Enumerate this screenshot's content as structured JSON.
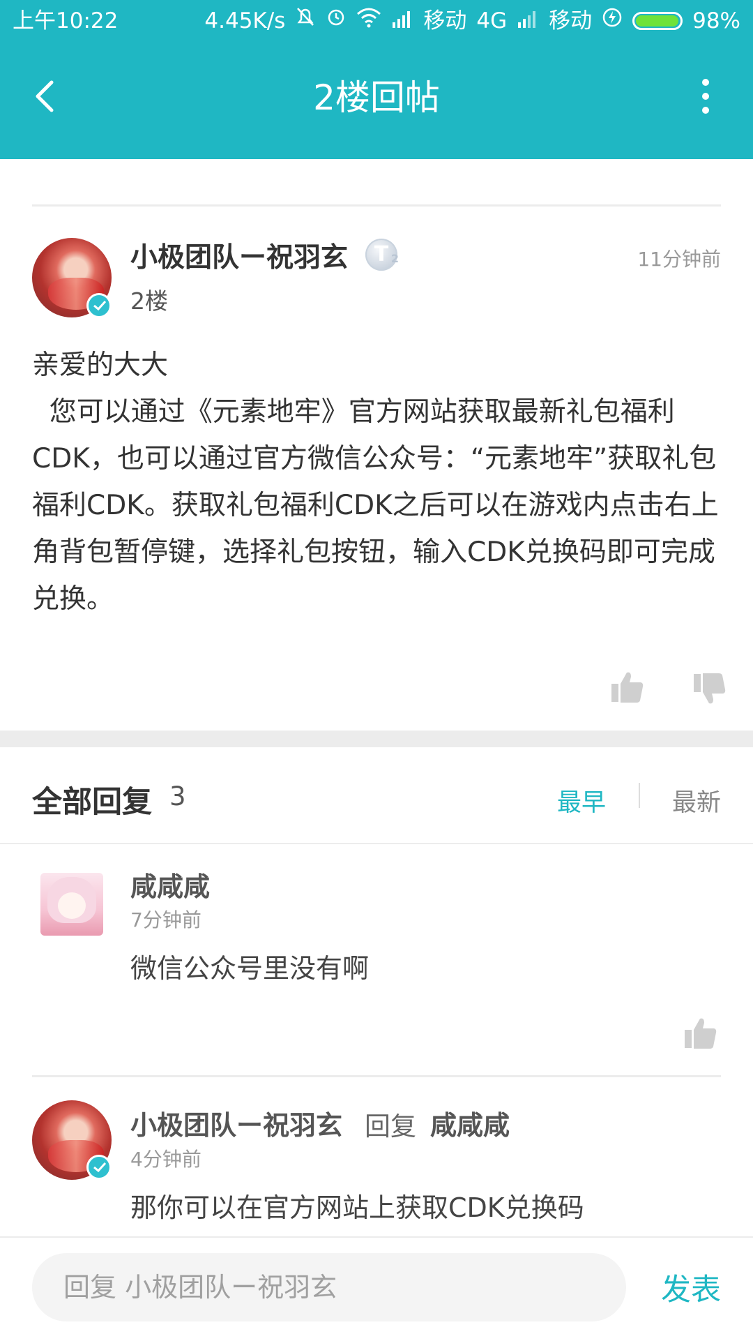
{
  "status_bar": {
    "time": "上午10:22",
    "speed": "4.45K/s",
    "carrier1": "移动",
    "network": "4G",
    "carrier2": "移动",
    "battery_text": "98%",
    "battery_level": 0.98
  },
  "header": {
    "title": "2楼回帖"
  },
  "post": {
    "author": "小极团队ー祝羽玄",
    "rank": "T",
    "rank_level": "2",
    "floor": "2楼",
    "time": "11分钟前",
    "body": "亲爱的大大\n  您可以通过《元素地牢》官方网站获取最新礼包福利CDK，也可以通过官方微信公众号：“元素地牢”获取礼包福利CDK。获取礼包福利CDK之后可以在游戏内点击右上角背包暂停键，选择礼包按钮，输入CDK兑换码即可完成兑换。"
  },
  "replies": {
    "title": "全部回复",
    "count": "3",
    "sort_earliest": "最早",
    "sort_latest": "最新",
    "items": [
      {
        "name": "咸咸咸",
        "time": "7分钟前",
        "text": "微信公众号里没有啊"
      },
      {
        "name": "小极团队ー祝羽玄",
        "reply_word": "回复",
        "reply_to": "咸咸咸",
        "time": "4分钟前",
        "text": "那你可以在官方网站上获取CDK兑换码"
      }
    ]
  },
  "composer": {
    "placeholder": "回复 小极团队ー祝羽玄",
    "send_label": "发表"
  },
  "colors": {
    "accent": "#1fb7c3"
  }
}
